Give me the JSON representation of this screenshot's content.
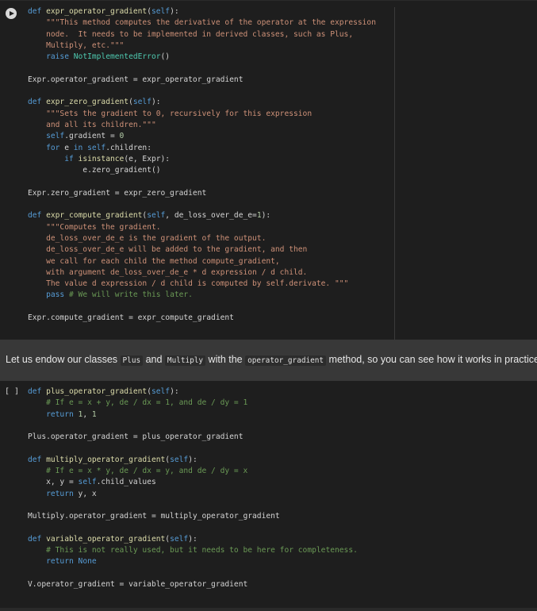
{
  "cell1": {
    "lines": [
      [
        {
          "t": "def ",
          "c": "k"
        },
        {
          "t": "expr_operator_gradient",
          "c": "f"
        },
        {
          "t": "(",
          "c": ""
        },
        {
          "t": "self",
          "c": "k"
        },
        {
          "t": "):",
          "c": ""
        }
      ],
      [
        {
          "t": "    \"\"\"This method computes the derivative of the operator at the expression",
          "c": "s"
        }
      ],
      [
        {
          "t": "    node.  It needs to be implemented in derived classes, such as Plus,",
          "c": "s"
        }
      ],
      [
        {
          "t": "    Multiply, etc.\"\"\"",
          "c": "s"
        }
      ],
      [
        {
          "t": "    ",
          "c": ""
        },
        {
          "t": "raise ",
          "c": "k"
        },
        {
          "t": "NotImplementedError",
          "c": "bl"
        },
        {
          "t": "()",
          "c": ""
        }
      ],
      [],
      [
        {
          "t": "Expr.operator_gradient = expr_operator_gradient",
          "c": ""
        }
      ],
      [],
      [
        {
          "t": "def ",
          "c": "k"
        },
        {
          "t": "expr_zero_gradient",
          "c": "f"
        },
        {
          "t": "(",
          "c": ""
        },
        {
          "t": "self",
          "c": "k"
        },
        {
          "t": "):",
          "c": ""
        }
      ],
      [
        {
          "t": "    \"\"\"Sets the gradient to 0, recursively for this expression",
          "c": "s"
        }
      ],
      [
        {
          "t": "    and all its children.\"\"\"",
          "c": "s"
        }
      ],
      [
        {
          "t": "    ",
          "c": ""
        },
        {
          "t": "self",
          "c": "k"
        },
        {
          "t": ".gradient = ",
          "c": ""
        },
        {
          "t": "0",
          "c": "n"
        }
      ],
      [
        {
          "t": "    ",
          "c": ""
        },
        {
          "t": "for ",
          "c": "k"
        },
        {
          "t": "e ",
          "c": ""
        },
        {
          "t": "in ",
          "c": "k"
        },
        {
          "t": "self",
          "c": "k"
        },
        {
          "t": ".children:",
          "c": ""
        }
      ],
      [
        {
          "t": "        ",
          "c": ""
        },
        {
          "t": "if ",
          "c": "k"
        },
        {
          "t": "isinstance",
          "c": "f"
        },
        {
          "t": "(e, Expr):",
          "c": ""
        }
      ],
      [
        {
          "t": "            e.zero_gradient()",
          "c": ""
        }
      ],
      [],
      [
        {
          "t": "Expr.zero_gradient = expr_zero_gradient",
          "c": ""
        }
      ],
      [],
      [
        {
          "t": "def ",
          "c": "k"
        },
        {
          "t": "expr_compute_gradient",
          "c": "f"
        },
        {
          "t": "(",
          "c": ""
        },
        {
          "t": "self",
          "c": "k"
        },
        {
          "t": ", de_loss_over_de_e=",
          "c": ""
        },
        {
          "t": "1",
          "c": "n"
        },
        {
          "t": "):",
          "c": ""
        }
      ],
      [
        {
          "t": "    \"\"\"Computes the gradient.",
          "c": "s"
        }
      ],
      [
        {
          "t": "    de_loss_over_de_e is the gradient of the output.",
          "c": "s"
        }
      ],
      [
        {
          "t": "    de_loss_over_de_e will be added to the gradient, and then",
          "c": "s"
        }
      ],
      [
        {
          "t": "    we call for each child the method compute_gradient,",
          "c": "s"
        }
      ],
      [
        {
          "t": "    with argument de_loss_over_de_e * d expression / d child.",
          "c": "s"
        }
      ],
      [
        {
          "t": "    The value d expression / d child is computed by self.derivate. \"\"\"",
          "c": "s"
        }
      ],
      [
        {
          "t": "    ",
          "c": ""
        },
        {
          "t": "pass ",
          "c": "k"
        },
        {
          "t": "# We will write this later.",
          "c": "c"
        }
      ],
      [],
      [
        {
          "t": "Expr.compute_gradient = expr_compute_gradient",
          "c": ""
        }
      ]
    ]
  },
  "markdown": {
    "before_plus": "Let us endow our classes ",
    "code_plus": "Plus",
    "between": " and ",
    "code_multiply": "Multiply",
    "before_method": " with the ",
    "code_method": "operator_gradient",
    "after": " method, so you can see how it works in practice."
  },
  "cell2": {
    "exec_count": "[ ]",
    "lines": [
      [
        {
          "t": "def ",
          "c": "k"
        },
        {
          "t": "plus_operator_gradient",
          "c": "f"
        },
        {
          "t": "(",
          "c": ""
        },
        {
          "t": "self",
          "c": "k"
        },
        {
          "t": "):",
          "c": ""
        }
      ],
      [
        {
          "t": "    ",
          "c": ""
        },
        {
          "t": "# If e = x + y, de / dx = 1, and de / dy = 1",
          "c": "c"
        }
      ],
      [
        {
          "t": "    ",
          "c": ""
        },
        {
          "t": "return ",
          "c": "k"
        },
        {
          "t": "1",
          "c": "n"
        },
        {
          "t": ", ",
          "c": ""
        },
        {
          "t": "1",
          "c": "n"
        }
      ],
      [],
      [
        {
          "t": "Plus.operator_gradient = plus_operator_gradient",
          "c": ""
        }
      ],
      [],
      [
        {
          "t": "def ",
          "c": "k"
        },
        {
          "t": "multiply_operator_gradient",
          "c": "f"
        },
        {
          "t": "(",
          "c": ""
        },
        {
          "t": "self",
          "c": "k"
        },
        {
          "t": "):",
          "c": ""
        }
      ],
      [
        {
          "t": "    ",
          "c": ""
        },
        {
          "t": "# If e = x * y, de / dx = y, and de / dy = x",
          "c": "c"
        }
      ],
      [
        {
          "t": "    x, y = ",
          "c": ""
        },
        {
          "t": "self",
          "c": "k"
        },
        {
          "t": ".child_values",
          "c": ""
        }
      ],
      [
        {
          "t": "    ",
          "c": ""
        },
        {
          "t": "return ",
          "c": "k"
        },
        {
          "t": "y, x",
          "c": ""
        }
      ],
      [],
      [
        {
          "t": "Multiply.operator_gradient = multiply_operator_gradient",
          "c": ""
        }
      ],
      [],
      [
        {
          "t": "def ",
          "c": "k"
        },
        {
          "t": "variable_operator_gradient",
          "c": "f"
        },
        {
          "t": "(",
          "c": ""
        },
        {
          "t": "self",
          "c": "k"
        },
        {
          "t": "):",
          "c": ""
        }
      ],
      [
        {
          "t": "    ",
          "c": ""
        },
        {
          "t": "# This is not really used, but it needs to be here for completeness.",
          "c": "c"
        }
      ],
      [
        {
          "t": "    ",
          "c": ""
        },
        {
          "t": "return ",
          "c": "k"
        },
        {
          "t": "None",
          "c": "k"
        }
      ],
      [],
      [
        {
          "t": "V.operator_gradient = variable_operator_gradient",
          "c": ""
        }
      ]
    ]
  }
}
